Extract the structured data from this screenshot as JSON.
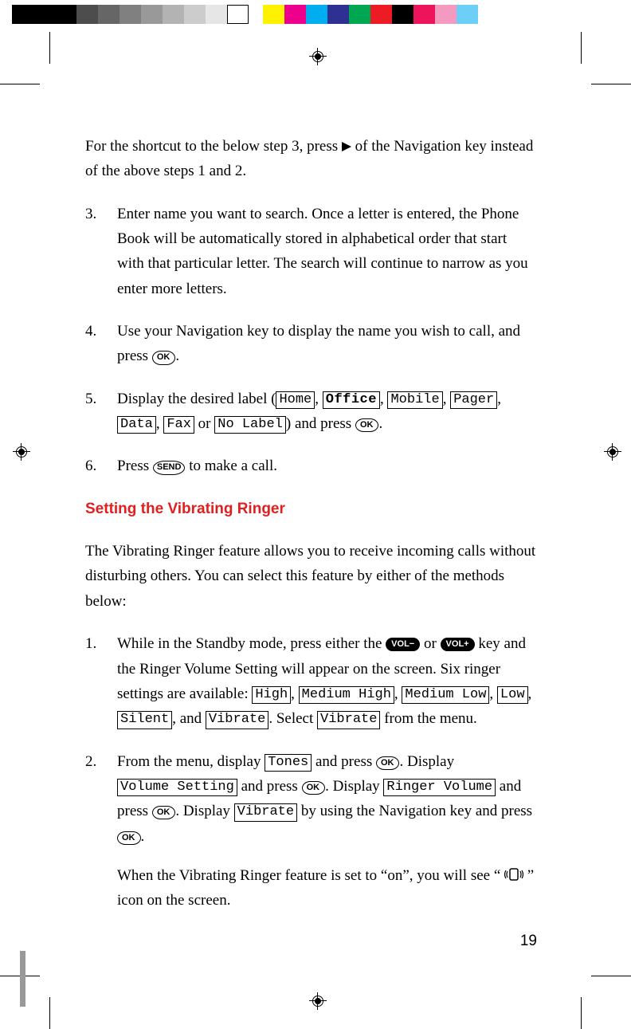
{
  "intro": "For the shortcut to the below step 3, press ▶ of the Navigation key instead of the above steps 1 and 2.",
  "steps_a": [
    {
      "n": "3.",
      "text_before": "Enter name you want to search. Once a letter is entered, the Phone Book will be automatically stored in alphabetical order that start with that particular letter. The search will continue to narrow as you enter more letters."
    },
    {
      "n": "4.",
      "text": "Use your Navigation key to display the name you wish to call, and press ",
      "key": "OK",
      "after": "."
    },
    {
      "n": "5.",
      "prefix": "Display the desired label (",
      "labels": [
        "Home",
        "Office",
        "Mobile",
        "Pager",
        "Data",
        "Fax"
      ],
      "no_label": "No Label",
      "mid": ") and press ",
      "key": "OK",
      "after": "."
    },
    {
      "n": "6.",
      "text": "Press ",
      "key": "SEND",
      "after": " to make a call."
    }
  ],
  "heading": "Setting the Vibrating Ringer",
  "section_intro": "The Vibrating Ringer feature allows you to receive incoming calls without disturbing others. You can select this feature by either of the methods below:",
  "steps_b": [
    {
      "n": "1.",
      "pre": "While in the Standby mode, press either the ",
      "vol_minus": "VOL−",
      "or": " or ",
      "vol_plus": "VOL+",
      "post": " key and the Ringer Volume Setting will appear on the screen. Six ringer settings are available: ",
      "settings": [
        "High",
        "Medium High",
        "Medium Low",
        "Low",
        "Silent"
      ],
      "and": ", and ",
      "vibrate": "Vibrate",
      "select": ". Select ",
      "vibrate2": "Vibrate",
      "from": " from the menu."
    },
    {
      "n": "2.",
      "t1": "From the menu, display ",
      "tones": "Tones",
      "t2": " and press ",
      "ok": "OK",
      "t3": ". Display ",
      "vs": "Volume Setting",
      "t4": " and press ",
      "t5": ". Display ",
      "rv": "Ringer Volume",
      "t6": " and press ",
      "t7": ". Display ",
      "vib": "Vibrate",
      "t8": " by using the Navigation key and press ",
      "t9": "."
    }
  ],
  "note": {
    "pre": "When the Vibrating Ringer feature is set to “on”, you will see “ ",
    "post": " ” icon on the screen."
  },
  "page_number": "19",
  "colors_left": [
    "#000",
    "#000",
    "#000",
    "#333",
    "#555",
    "#777",
    "#999",
    "#bbb",
    "#ddd",
    "#fff"
  ],
  "colors_right": [
    "#ffe600",
    "#e6007e",
    "#00aeef",
    "#ec008c",
    "#00a651",
    "#2e3192",
    "#000",
    "#ed1c24",
    "#f49ac1",
    "#6dcff6"
  ]
}
